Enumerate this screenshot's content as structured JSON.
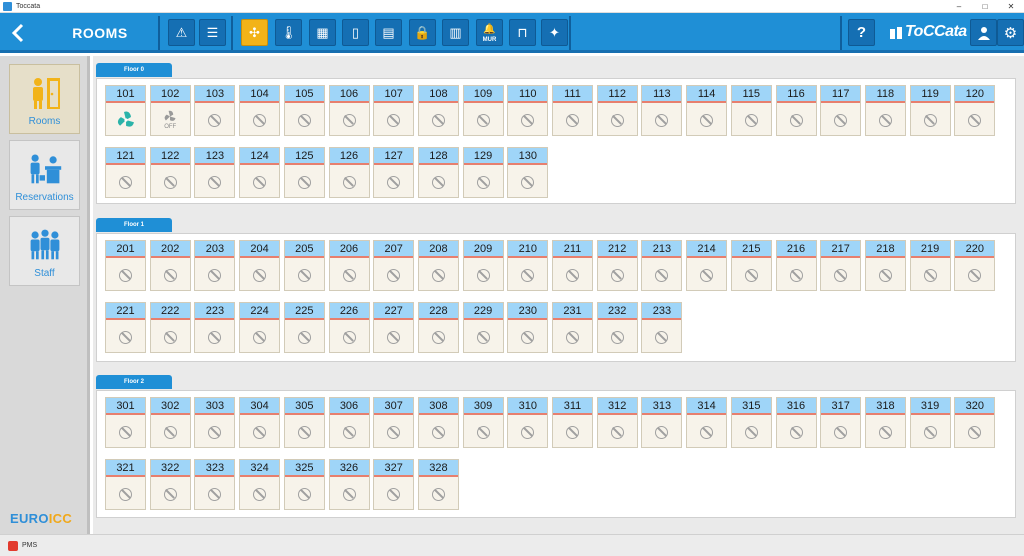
{
  "window": {
    "title": "Toccata",
    "minimize": "–",
    "maximize": "□",
    "close": "✕"
  },
  "header": {
    "back_icon": "chevron-left-icon",
    "title": "ROOMS",
    "brand": "ToCCata"
  },
  "toolbar_buttons": [
    {
      "name": "alert",
      "icon": "⚠"
    },
    {
      "name": "list",
      "icon": "☰"
    },
    {
      "name": "hvac-fan",
      "icon": "✣",
      "active": true
    },
    {
      "name": "temperature",
      "icon": "🌡"
    },
    {
      "name": "thermostat",
      "icon": "▦"
    },
    {
      "name": "door",
      "icon": "▯"
    },
    {
      "name": "card",
      "icon": "▤"
    },
    {
      "name": "lock",
      "icon": "🔒"
    },
    {
      "name": "panel",
      "icon": "▥"
    },
    {
      "name": "mur",
      "icon": "🔔",
      "text": "MUR"
    },
    {
      "name": "curtains",
      "icon": "⊓"
    },
    {
      "name": "housekeeping",
      "icon": "✦"
    }
  ],
  "toolbar_right": [
    {
      "name": "help",
      "icon": "?"
    },
    {
      "name": "user",
      "icon": "👤"
    },
    {
      "name": "settings",
      "icon": "⚙"
    }
  ],
  "sidebar": {
    "items": [
      {
        "label": "Rooms",
        "active": true
      },
      {
        "label": "Reservations",
        "active": false
      },
      {
        "label": "Staff",
        "active": false
      }
    ],
    "brand_left": "EURO",
    "brand_right": "ICC"
  },
  "floors": [
    {
      "label": "Floor 0",
      "rows": [
        [
          "101",
          "102",
          "103",
          "104",
          "105",
          "106",
          "107",
          "108",
          "109",
          "110",
          "111",
          "112",
          "113",
          "114",
          "115",
          "116",
          "117",
          "118",
          "119",
          "120"
        ],
        [
          "121",
          "122",
          "123",
          "124",
          "125",
          "126",
          "127",
          "128",
          "129",
          "130"
        ]
      ]
    },
    {
      "label": "Floor 1",
      "rows": [
        [
          "201",
          "202",
          "203",
          "204",
          "205",
          "206",
          "207",
          "208",
          "209",
          "210",
          "211",
          "212",
          "213",
          "214",
          "215",
          "216",
          "217",
          "218",
          "219",
          "220"
        ],
        [
          "221",
          "222",
          "223",
          "224",
          "225",
          "226",
          "227",
          "228",
          "229",
          "230",
          "231",
          "232",
          "233"
        ]
      ]
    },
    {
      "label": "Floor 2",
      "rows": [
        [
          "301",
          "302",
          "303",
          "304",
          "305",
          "306",
          "307",
          "308",
          "309",
          "310",
          "311",
          "312",
          "313",
          "314",
          "315",
          "316",
          "317",
          "318",
          "319",
          "320"
        ],
        [
          "321",
          "322",
          "323",
          "324",
          "325",
          "326",
          "327",
          "328"
        ]
      ]
    }
  ],
  "room_states": {
    "101": {
      "state": "fan-on",
      "icon": "fan-icon"
    },
    "102": {
      "state": "fan-off",
      "icon": "fan-off-icon",
      "text": "OFF"
    }
  },
  "default_room_state": {
    "state": "unavailable",
    "icon": "no-entry-icon"
  },
  "colors": {
    "primary": "#1f8fd6",
    "accent": "#f2b318",
    "room_header": "#9fd5f8",
    "room_line": "#e77f6e",
    "fan_on": "#2bb3a9"
  },
  "status_bar": {
    "label": "PMS"
  }
}
